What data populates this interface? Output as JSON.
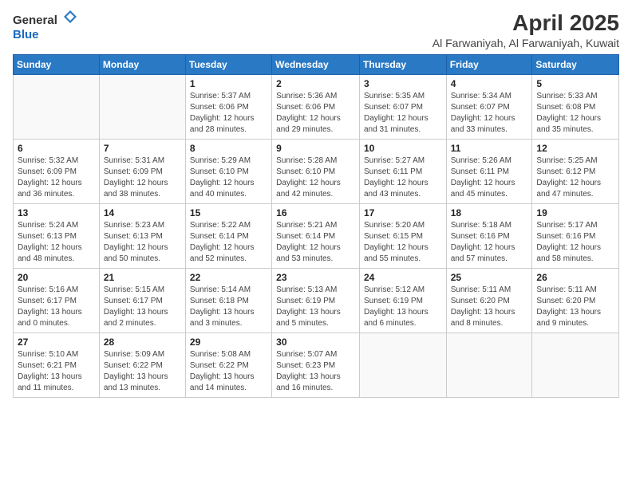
{
  "app": {
    "logo_general": "General",
    "logo_blue": "Blue",
    "title": "April 2025",
    "subtitle": "Al Farwaniyah, Al Farwaniyah, Kuwait"
  },
  "calendar": {
    "headers": [
      "Sunday",
      "Monday",
      "Tuesday",
      "Wednesday",
      "Thursday",
      "Friday",
      "Saturday"
    ],
    "weeks": [
      [
        {
          "day": "",
          "sunrise": "",
          "sunset": "",
          "daylight": ""
        },
        {
          "day": "",
          "sunrise": "",
          "sunset": "",
          "daylight": ""
        },
        {
          "day": "1",
          "sunrise": "Sunrise: 5:37 AM",
          "sunset": "Sunset: 6:06 PM",
          "daylight": "Daylight: 12 hours and 28 minutes."
        },
        {
          "day": "2",
          "sunrise": "Sunrise: 5:36 AM",
          "sunset": "Sunset: 6:06 PM",
          "daylight": "Daylight: 12 hours and 29 minutes."
        },
        {
          "day": "3",
          "sunrise": "Sunrise: 5:35 AM",
          "sunset": "Sunset: 6:07 PM",
          "daylight": "Daylight: 12 hours and 31 minutes."
        },
        {
          "day": "4",
          "sunrise": "Sunrise: 5:34 AM",
          "sunset": "Sunset: 6:07 PM",
          "daylight": "Daylight: 12 hours and 33 minutes."
        },
        {
          "day": "5",
          "sunrise": "Sunrise: 5:33 AM",
          "sunset": "Sunset: 6:08 PM",
          "daylight": "Daylight: 12 hours and 35 minutes."
        }
      ],
      [
        {
          "day": "6",
          "sunrise": "Sunrise: 5:32 AM",
          "sunset": "Sunset: 6:09 PM",
          "daylight": "Daylight: 12 hours and 36 minutes."
        },
        {
          "day": "7",
          "sunrise": "Sunrise: 5:31 AM",
          "sunset": "Sunset: 6:09 PM",
          "daylight": "Daylight: 12 hours and 38 minutes."
        },
        {
          "day": "8",
          "sunrise": "Sunrise: 5:29 AM",
          "sunset": "Sunset: 6:10 PM",
          "daylight": "Daylight: 12 hours and 40 minutes."
        },
        {
          "day": "9",
          "sunrise": "Sunrise: 5:28 AM",
          "sunset": "Sunset: 6:10 PM",
          "daylight": "Daylight: 12 hours and 42 minutes."
        },
        {
          "day": "10",
          "sunrise": "Sunrise: 5:27 AM",
          "sunset": "Sunset: 6:11 PM",
          "daylight": "Daylight: 12 hours and 43 minutes."
        },
        {
          "day": "11",
          "sunrise": "Sunrise: 5:26 AM",
          "sunset": "Sunset: 6:11 PM",
          "daylight": "Daylight: 12 hours and 45 minutes."
        },
        {
          "day": "12",
          "sunrise": "Sunrise: 5:25 AM",
          "sunset": "Sunset: 6:12 PM",
          "daylight": "Daylight: 12 hours and 47 minutes."
        }
      ],
      [
        {
          "day": "13",
          "sunrise": "Sunrise: 5:24 AM",
          "sunset": "Sunset: 6:13 PM",
          "daylight": "Daylight: 12 hours and 48 minutes."
        },
        {
          "day": "14",
          "sunrise": "Sunrise: 5:23 AM",
          "sunset": "Sunset: 6:13 PM",
          "daylight": "Daylight: 12 hours and 50 minutes."
        },
        {
          "day": "15",
          "sunrise": "Sunrise: 5:22 AM",
          "sunset": "Sunset: 6:14 PM",
          "daylight": "Daylight: 12 hours and 52 minutes."
        },
        {
          "day": "16",
          "sunrise": "Sunrise: 5:21 AM",
          "sunset": "Sunset: 6:14 PM",
          "daylight": "Daylight: 12 hours and 53 minutes."
        },
        {
          "day": "17",
          "sunrise": "Sunrise: 5:20 AM",
          "sunset": "Sunset: 6:15 PM",
          "daylight": "Daylight: 12 hours and 55 minutes."
        },
        {
          "day": "18",
          "sunrise": "Sunrise: 5:18 AM",
          "sunset": "Sunset: 6:16 PM",
          "daylight": "Daylight: 12 hours and 57 minutes."
        },
        {
          "day": "19",
          "sunrise": "Sunrise: 5:17 AM",
          "sunset": "Sunset: 6:16 PM",
          "daylight": "Daylight: 12 hours and 58 minutes."
        }
      ],
      [
        {
          "day": "20",
          "sunrise": "Sunrise: 5:16 AM",
          "sunset": "Sunset: 6:17 PM",
          "daylight": "Daylight: 13 hours and 0 minutes."
        },
        {
          "day": "21",
          "sunrise": "Sunrise: 5:15 AM",
          "sunset": "Sunset: 6:17 PM",
          "daylight": "Daylight: 13 hours and 2 minutes."
        },
        {
          "day": "22",
          "sunrise": "Sunrise: 5:14 AM",
          "sunset": "Sunset: 6:18 PM",
          "daylight": "Daylight: 13 hours and 3 minutes."
        },
        {
          "day": "23",
          "sunrise": "Sunrise: 5:13 AM",
          "sunset": "Sunset: 6:19 PM",
          "daylight": "Daylight: 13 hours and 5 minutes."
        },
        {
          "day": "24",
          "sunrise": "Sunrise: 5:12 AM",
          "sunset": "Sunset: 6:19 PM",
          "daylight": "Daylight: 13 hours and 6 minutes."
        },
        {
          "day": "25",
          "sunrise": "Sunrise: 5:11 AM",
          "sunset": "Sunset: 6:20 PM",
          "daylight": "Daylight: 13 hours and 8 minutes."
        },
        {
          "day": "26",
          "sunrise": "Sunrise: 5:11 AM",
          "sunset": "Sunset: 6:20 PM",
          "daylight": "Daylight: 13 hours and 9 minutes."
        }
      ],
      [
        {
          "day": "27",
          "sunrise": "Sunrise: 5:10 AM",
          "sunset": "Sunset: 6:21 PM",
          "daylight": "Daylight: 13 hours and 11 minutes."
        },
        {
          "day": "28",
          "sunrise": "Sunrise: 5:09 AM",
          "sunset": "Sunset: 6:22 PM",
          "daylight": "Daylight: 13 hours and 13 minutes."
        },
        {
          "day": "29",
          "sunrise": "Sunrise: 5:08 AM",
          "sunset": "Sunset: 6:22 PM",
          "daylight": "Daylight: 13 hours and 14 minutes."
        },
        {
          "day": "30",
          "sunrise": "Sunrise: 5:07 AM",
          "sunset": "Sunset: 6:23 PM",
          "daylight": "Daylight: 13 hours and 16 minutes."
        },
        {
          "day": "",
          "sunrise": "",
          "sunset": "",
          "daylight": ""
        },
        {
          "day": "",
          "sunrise": "",
          "sunset": "",
          "daylight": ""
        },
        {
          "day": "",
          "sunrise": "",
          "sunset": "",
          "daylight": ""
        }
      ]
    ]
  }
}
